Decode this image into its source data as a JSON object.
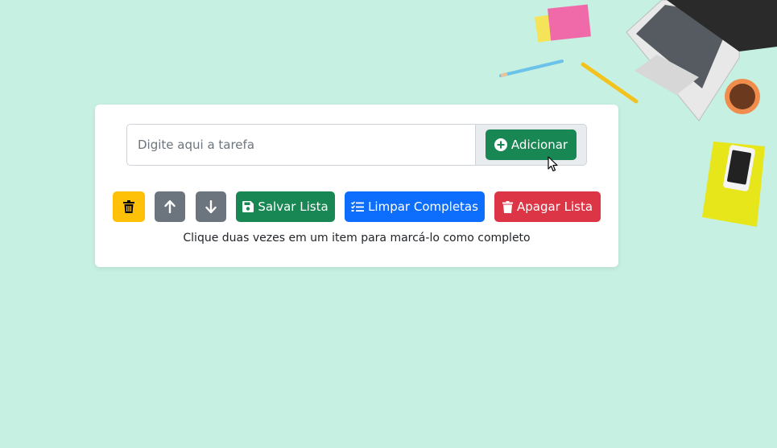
{
  "task_form": {
    "input_value": "",
    "input_placeholder": "Digite aqui a tarefa",
    "add_label": "Adicionar"
  },
  "toolbar": {
    "delete_item_icon": "trash-icon",
    "move_up_icon": "arrow-up-icon",
    "move_down_icon": "arrow-down-icon",
    "save_label": "Salvar Lista",
    "clear_completed_label": "Limpar Completas",
    "delete_list_label": "Apagar Lista"
  },
  "hint": "Clique duas vezes em um item para marcá-lo como completo",
  "colors": {
    "background": "#c6f0e2",
    "success": "#198754",
    "primary": "#0d6efd",
    "danger": "#dc3545",
    "warning": "#ffc107",
    "secondary": "#6c757d"
  }
}
